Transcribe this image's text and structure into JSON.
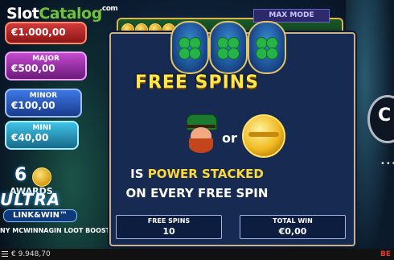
{
  "logo": {
    "slot": "Slot",
    "catalog": "Catalog",
    "com": ".com"
  },
  "jackpots": {
    "grand": {
      "label": "",
      "value": "€1.000,00"
    },
    "major": {
      "label": "MAJOR",
      "value": "€500,00"
    },
    "minor": {
      "label": "MINOR",
      "value": "€100,00"
    },
    "mini": {
      "label": "MINI",
      "value": "€40,00"
    }
  },
  "awards": {
    "count": "6",
    "text": "AWARDS"
  },
  "branding": {
    "ultra": "ULTRA",
    "link_win": "LINK&WIN™",
    "boost": "NY MCWINNAGIN LOOT BOOST"
  },
  "max_mode": "MAX MODE",
  "free_spins_popup": {
    "title": "FREE SPINS",
    "or": "or",
    "line1_prefix": "IS ",
    "line1_highlight": "POWER STACKED",
    "line2": "ON EVERY FREE SPIN"
  },
  "stats": {
    "free_spins_label": "FREE SPINS",
    "free_spins_value": "10",
    "total_win_label": "TOTAL WIN",
    "total_win_value": "€0,00"
  },
  "footer": {
    "balance": "€ 9.948,70",
    "bet": "BE"
  },
  "right_ui": {
    "more": "•••"
  },
  "colors": {
    "title_yellow": "#ffe74a",
    "panel": "#162a52",
    "accent_green": "#6fc23a"
  }
}
